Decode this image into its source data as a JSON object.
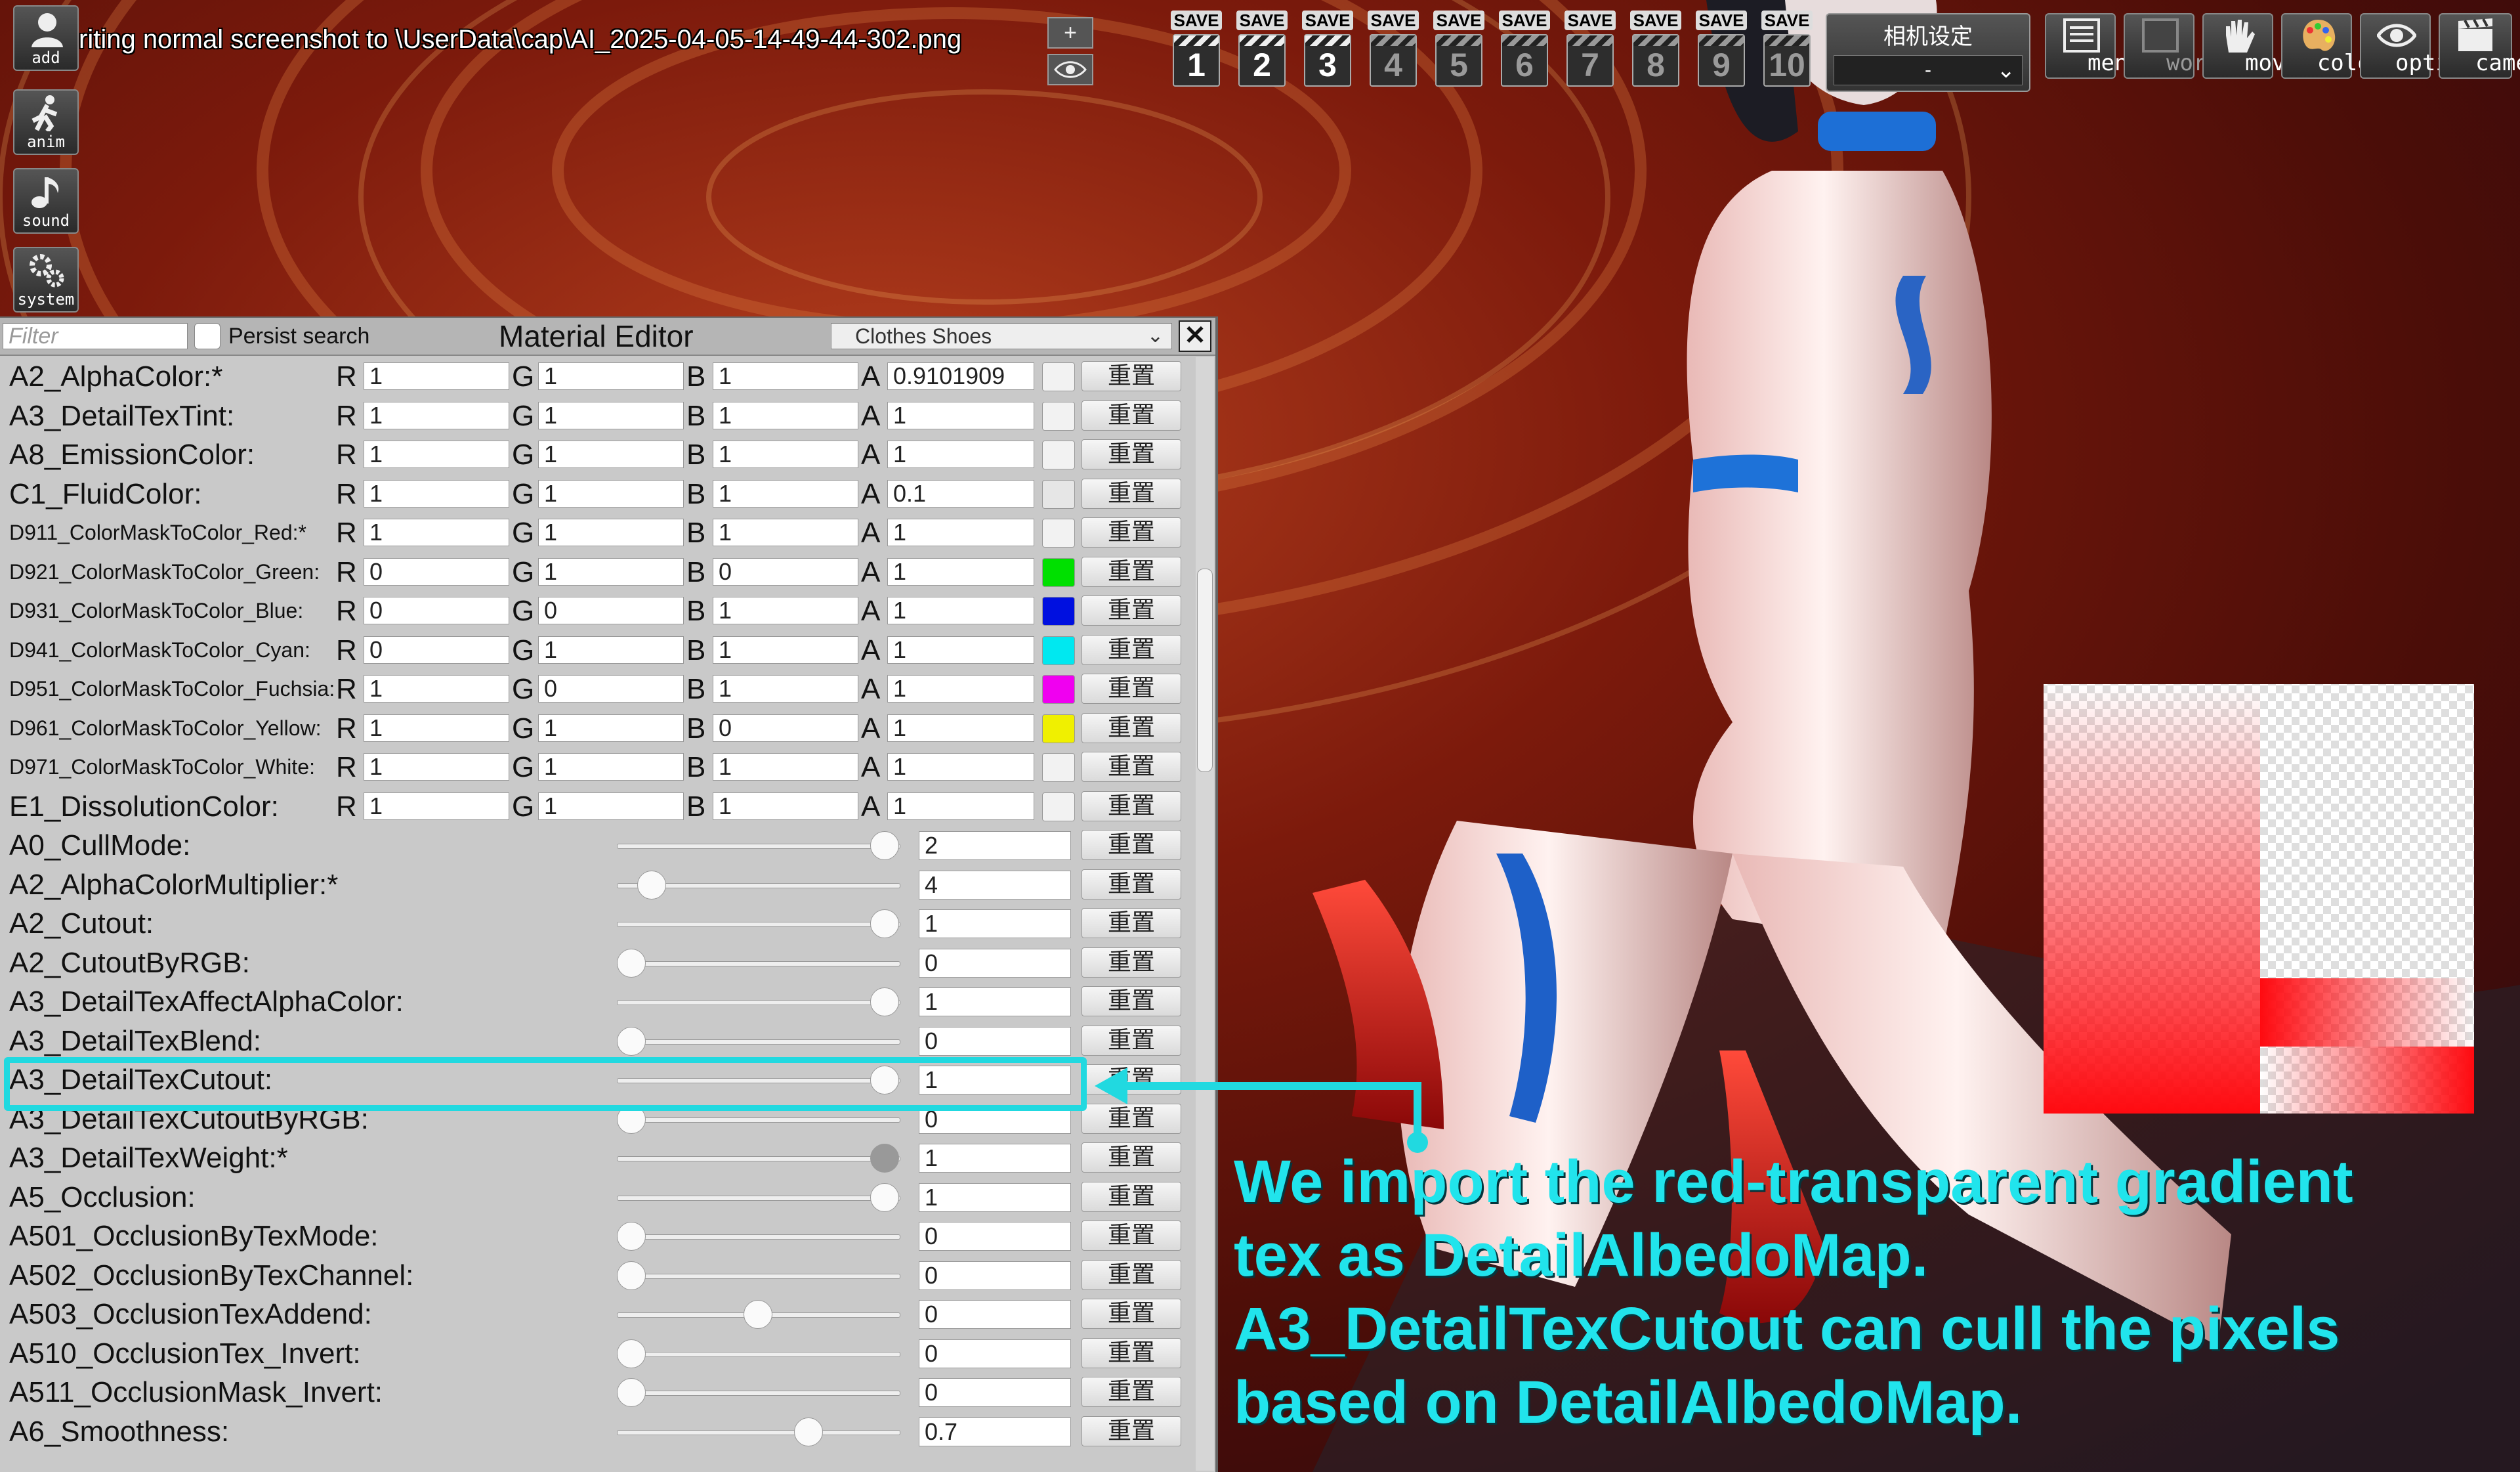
{
  "capture_message": "riting normal screenshot to \\UserData\\cap\\AI_2025-04-05-14-49-44-302.png",
  "left_toolbar": [
    {
      "label": "add",
      "icon": "add-character-icon"
    },
    {
      "label": "anim",
      "icon": "running-figure-icon"
    },
    {
      "label": "sound",
      "icon": "music-note-icon"
    },
    {
      "label": "system",
      "icon": "gears-icon"
    }
  ],
  "small_buttons": {
    "plus": "+",
    "eye_icon": "eye-icon"
  },
  "save_slots": {
    "label": "SAVE",
    "slots": [
      "1",
      "2",
      "3",
      "4",
      "5",
      "6",
      "7",
      "8",
      "9",
      "10"
    ]
  },
  "camera_settings": {
    "title": "相机设定",
    "selected": "-"
  },
  "right_toolbar": [
    {
      "label": "menu",
      "icon": "menu-list-icon"
    },
    {
      "label": "work",
      "icon": "work-icon"
    },
    {
      "label": "move",
      "icon": "hand-icon"
    },
    {
      "label": "color",
      "icon": "palette-icon"
    },
    {
      "label": "option",
      "icon": "eye-icon"
    },
    {
      "label": "camera",
      "icon": "clapperboard-icon"
    }
  ],
  "material_editor": {
    "title": "Material Editor",
    "filter_placeholder": "Filter",
    "persist_search_label": "Persist search",
    "renderer_selected": "Clothes Shoes",
    "close_label": "✕",
    "reset_label": "重置",
    "color_rows": [
      {
        "name": "A2_AlphaColor:*",
        "small": false,
        "r": "1",
        "g": "1",
        "b": "1",
        "a": "0.9101909",
        "swatch": "#f2f2f2"
      },
      {
        "name": "A3_DetailTexTint:",
        "small": false,
        "r": "1",
        "g": "1",
        "b": "1",
        "a": "1",
        "swatch": "#f2f2f2"
      },
      {
        "name": "A8_EmissionColor:",
        "small": false,
        "r": "1",
        "g": "1",
        "b": "1",
        "a": "1",
        "swatch": "#f2f2f2"
      },
      {
        "name": "C1_FluidColor:",
        "small": false,
        "r": "1",
        "g": "1",
        "b": "1",
        "a": "0.1",
        "swatch": "#e6e6e6"
      },
      {
        "name": "D911_ColorMaskToColor_Red:*",
        "small": true,
        "r": "1",
        "g": "1",
        "b": "1",
        "a": "1",
        "swatch": "#f2f2f2"
      },
      {
        "name": "D921_ColorMaskToColor_Green:",
        "small": true,
        "r": "0",
        "g": "1",
        "b": "0",
        "a": "1",
        "swatch": "#00e000"
      },
      {
        "name": "D931_ColorMaskToColor_Blue:",
        "small": true,
        "r": "0",
        "g": "0",
        "b": "1",
        "a": "1",
        "swatch": "#0010e0"
      },
      {
        "name": "D941_ColorMaskToColor_Cyan:",
        "small": true,
        "r": "0",
        "g": "1",
        "b": "1",
        "a": "1",
        "swatch": "#00e8f0"
      },
      {
        "name": "D951_ColorMaskToColor_Fuchsia:",
        "small": true,
        "r": "1",
        "g": "0",
        "b": "1",
        "a": "1",
        "swatch": "#f000f0"
      },
      {
        "name": "D961_ColorMaskToColor_Yellow:",
        "small": true,
        "r": "1",
        "g": "1",
        "b": "0",
        "a": "1",
        "swatch": "#f0f000"
      },
      {
        "name": "D971_ColorMaskToColor_White:",
        "small": true,
        "r": "1",
        "g": "1",
        "b": "1",
        "a": "1",
        "swatch": "#f2f2f2"
      },
      {
        "name": "E1_DissolutionColor:",
        "small": false,
        "r": "1",
        "g": "1",
        "b": "1",
        "a": "1",
        "swatch": "#f2f2f2"
      }
    ],
    "float_rows": [
      {
        "name": "A0_CullMode:",
        "value": "2",
        "slider": 1.0
      },
      {
        "name": "A2_AlphaColorMultiplier:*",
        "value": "4",
        "slider": 0.08
      },
      {
        "name": "A2_Cutout:",
        "value": "1",
        "slider": 1.0
      },
      {
        "name": "A2_CutoutByRGB:",
        "value": "0",
        "slider": 0.0
      },
      {
        "name": "A3_DetailTexAffectAlphaColor:",
        "value": "1",
        "slider": 1.0
      },
      {
        "name": "A3_DetailTexBlend:",
        "value": "0",
        "slider": 0.0
      },
      {
        "name": "A3_DetailTexCutout:",
        "value": "1",
        "slider": 1.0
      },
      {
        "name": "A3_DetailTexCutoutByRGB:",
        "value": "0",
        "slider": 0.0
      },
      {
        "name": "A3_DetailTexWeight:*",
        "value": "1",
        "slider": 1.0,
        "disabled": true
      },
      {
        "name": "A5_Occlusion:",
        "value": "1",
        "slider": 1.0
      },
      {
        "name": "A501_OcclusionByTexMode:",
        "value": "0",
        "slider": 0.0
      },
      {
        "name": "A502_OcclusionByTexChannel:",
        "value": "0",
        "slider": 0.0
      },
      {
        "name": "A503_OcclusionTexAddend:",
        "value": "0",
        "slider": 0.5
      },
      {
        "name": "A510_OcclusionTex_Invert:",
        "value": "0",
        "slider": 0.0
      },
      {
        "name": "A511_OcclusionMask_Invert:",
        "value": "0",
        "slider": 0.0
      },
      {
        "name": "A6_Smoothness:",
        "value": "0.7",
        "slider": 0.7
      }
    ]
  },
  "annotation": {
    "line1": "We import the red-transparent gradient",
    "line2": "tex as DetailAlbedoMap.",
    "line3": "A3_DetailTexCutout can cull the pixels",
    "line4": "based on DetailAlbedoMap.",
    "color": "#21e4ec"
  }
}
